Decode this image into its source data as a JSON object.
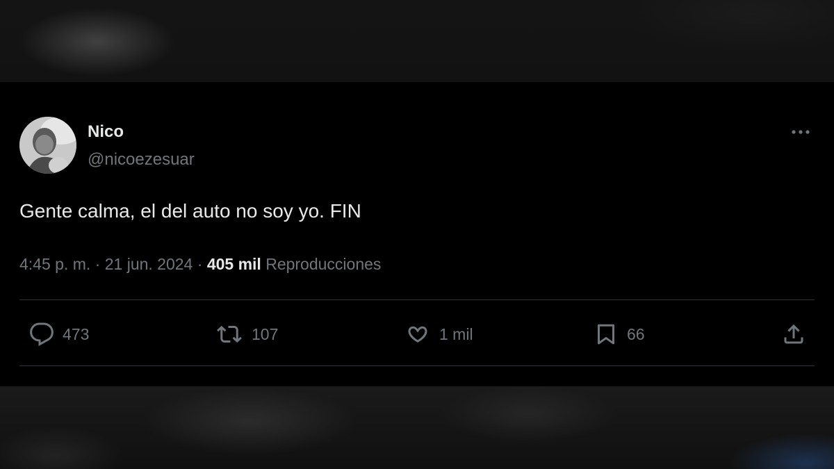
{
  "tweet": {
    "author_name": "Nico",
    "author_handle": "@nicoezesuar",
    "text": "Gente calma, el del auto no soy yo. FIN",
    "time": "4:45 p. m.",
    "sep1": "·",
    "date": "21 jun. 2024",
    "sep2": "·",
    "views_count": "405 mil",
    "views_label": "Reproducciones"
  },
  "actions": {
    "replies": "473",
    "reposts": "107",
    "likes": "1 mil",
    "bookmarks": "66"
  },
  "icons": {
    "more": "more-dots-icon",
    "reply": "reply-icon",
    "repost": "repost-icon",
    "like": "heart-icon",
    "bookmark": "bookmark-icon",
    "share": "share-icon"
  },
  "colors": {
    "background": "#000000",
    "primary_text": "#e7e9ea",
    "secondary_text": "#71767b",
    "divider": "#2f3336"
  }
}
